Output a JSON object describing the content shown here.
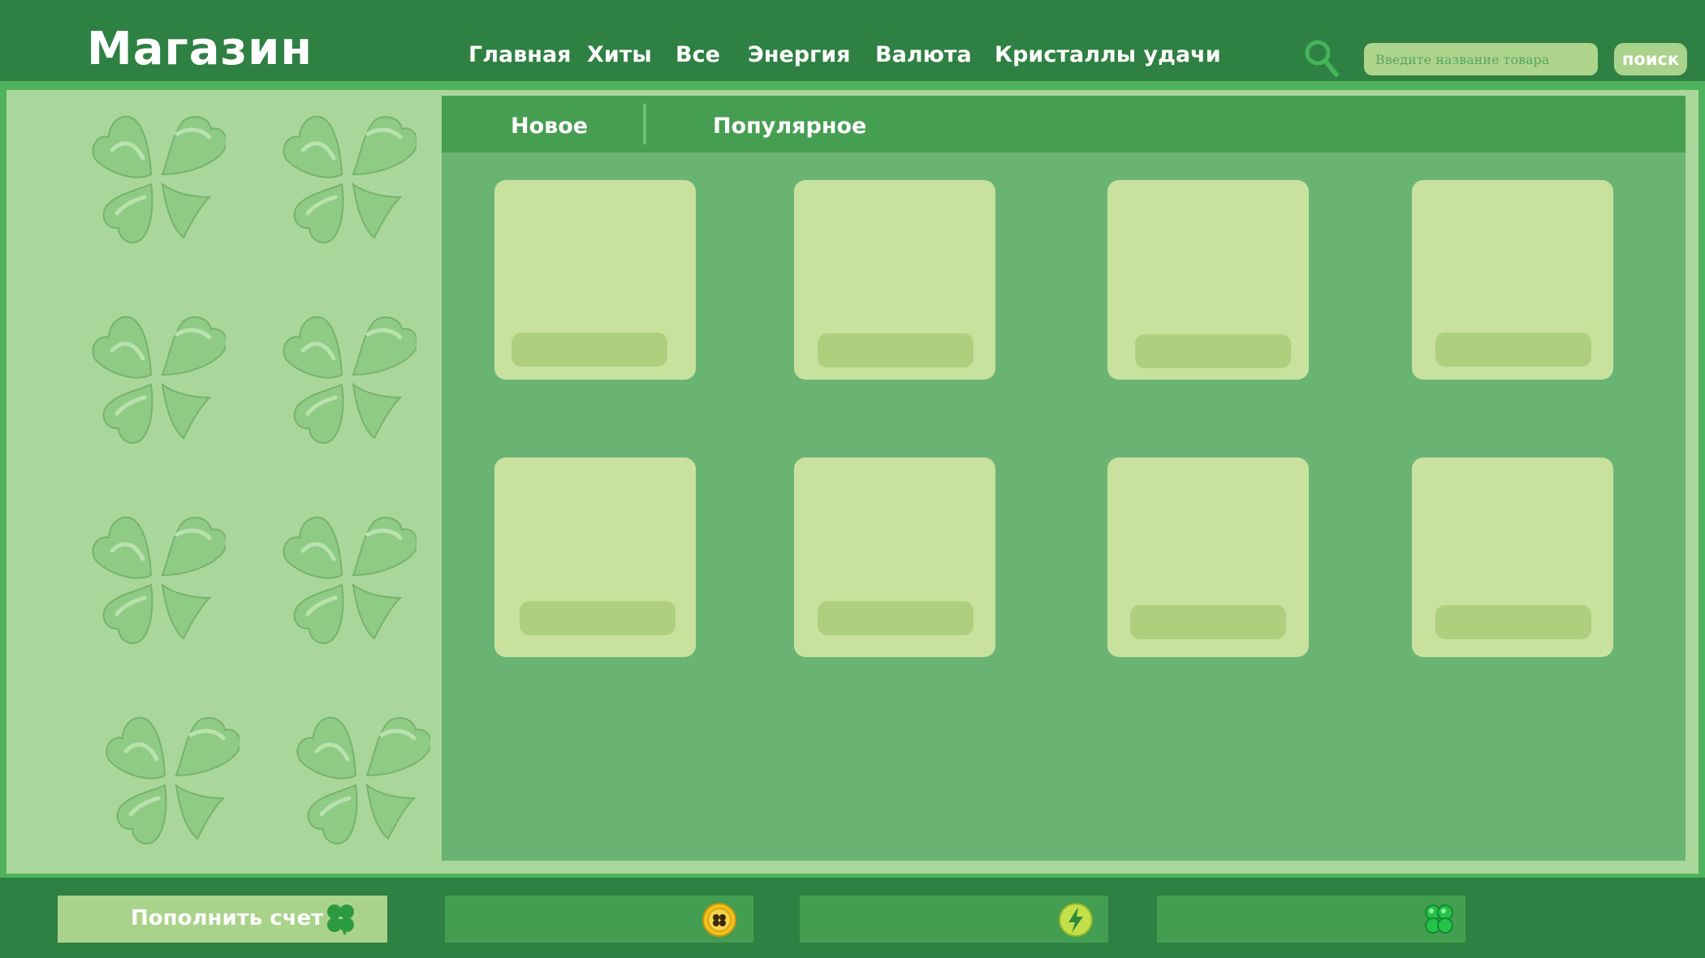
{
  "header": {
    "logo": "Магазин",
    "nav": [
      {
        "label": "Главная"
      },
      {
        "label": "Хиты"
      },
      {
        "label": "Все"
      },
      {
        "label": "Энергия"
      },
      {
        "label": "Валюта"
      },
      {
        "label": "Кристаллы удачи"
      }
    ],
    "search": {
      "placeholder": "Введите название товара",
      "button_label": "поиск",
      "icon": "search-icon"
    }
  },
  "tabs": [
    {
      "label": "Новое",
      "active": true
    },
    {
      "label": "Популярное",
      "active": false
    }
  ],
  "sidebar": {
    "decoration": "clover-icon",
    "clover_count": 8
  },
  "products": {
    "card_count": 8,
    "rows": 2,
    "columns": 4
  },
  "footer": {
    "topup_label": "Пополнить счет",
    "topup_icon": "clover-icon",
    "balances": [
      {
        "icon": "coin-icon",
        "value": ""
      },
      {
        "icon": "energy-icon",
        "value": ""
      },
      {
        "icon": "clover-crystal-icon",
        "value": ""
      }
    ]
  },
  "colors": {
    "header_bg": "#2e8043",
    "frame": "#4fb35d",
    "sidebar_bg": "#a9d79b",
    "content_bg": "#6ab473",
    "tabs_bg": "#459e52",
    "card_bg": "#c8e29e",
    "card_bar": "#adcf7e",
    "accent_button": "#a9d38a"
  }
}
